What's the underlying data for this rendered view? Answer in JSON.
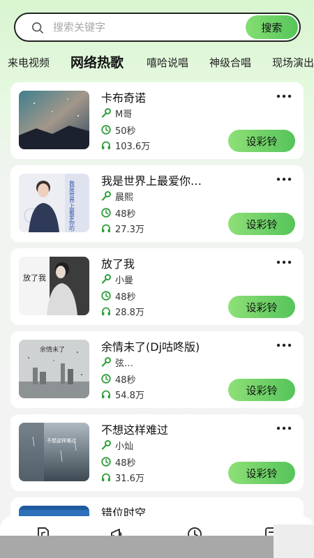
{
  "search": {
    "placeholder": "搜索关键字",
    "button_label": "搜索"
  },
  "tabs": [
    {
      "label": "来电视频"
    },
    {
      "label": "网络热歌"
    },
    {
      "label": "嘻哈说唱"
    },
    {
      "label": "神级合唱"
    },
    {
      "label": "现场演出"
    }
  ],
  "active_tab": "网络热歌",
  "songs": [
    {
      "title": "卡布奇诺",
      "artist": "M哥",
      "duration": "50秒",
      "plays": "103.6万",
      "action": "设彩铃"
    },
    {
      "title": "我是世界上最爱你…",
      "artist": "晨熙",
      "duration": "48秒",
      "plays": "27.3万",
      "action": "设彩铃"
    },
    {
      "title": "放了我",
      "artist": "小曼",
      "duration": "48秒",
      "plays": "28.8万",
      "action": "设彩铃"
    },
    {
      "title": "余情未了(Dj咕咚版)",
      "artist": "弦…",
      "duration": "48秒",
      "plays": "54.8万",
      "action": "设彩铃"
    },
    {
      "title": "不想这样难过",
      "artist": "小灿",
      "duration": "48秒",
      "plays": "31.6万",
      "action": "设彩铃"
    },
    {
      "title": "错位时空"
    }
  ],
  "cover_art_text": {
    "song2": [
      "我是世界上最爱你的人"
    ],
    "song3": [
      "放了我"
    ],
    "song4": [
      "余情未了"
    ],
    "song5": [
      "不想这样难过"
    ]
  },
  "colors": {
    "accent_green": "#56c55a",
    "accent_green_light": "#8ee077",
    "icon_green": "#2f9e3c"
  },
  "icons": {
    "meta_artist": "microphone-icon",
    "meta_duration": "clock-icon",
    "meta_plays": "headphones-icon",
    "card_more": "more-dots-icon"
  }
}
